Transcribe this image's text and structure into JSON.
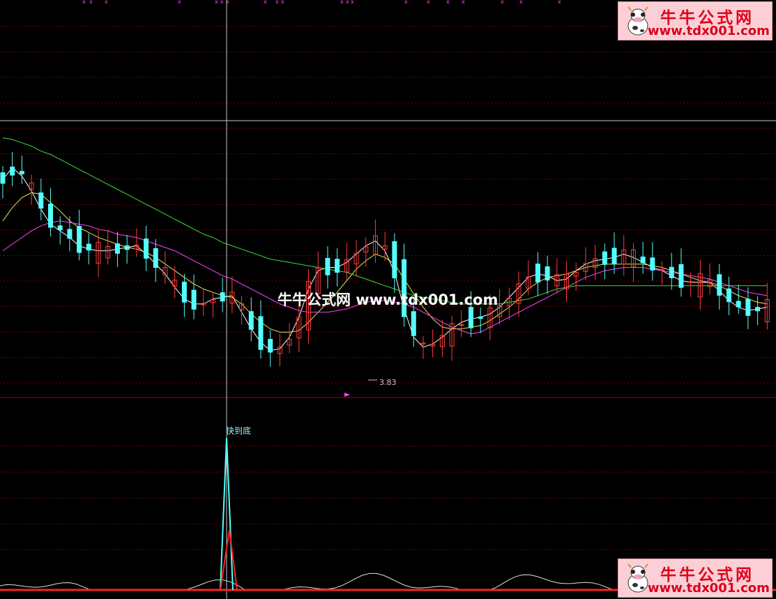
{
  "watermark_text": "牛牛公式网 www.tdx001.com",
  "badge": {
    "name": "牛牛公式网",
    "url": "www.tdx001.com",
    "icon": "cow-mascot-icon"
  },
  "colors": {
    "up": "#ff3c3c",
    "down": "#54ffff",
    "ma5": "#ffffff",
    "ma10": "#e6e64e",
    "ma20": "#ff44ff",
    "ma60": "#3edc3e",
    "grid": "#7a0000",
    "crosshair": "#c8c8c8",
    "signal": "#54ffff",
    "signal_red": "#ff2020"
  },
  "chart_data": [
    {
      "type": "candlestick",
      "title": "",
      "annotations": {
        "low_marker": "3.83",
        "top_marks": "x"
      },
      "ylim": [
        3.7,
        5.4
      ],
      "ohlc": [],
      "ma_series": [
        {
          "key": "ma5",
          "values": [
            4.95,
            5.02,
            4.97,
            4.88,
            4.77,
            4.68,
            4.64,
            4.6,
            4.55,
            4.53,
            4.52,
            4.52,
            4.53,
            4.54,
            4.55,
            4.5,
            4.44,
            4.38,
            4.3,
            4.23,
            4.2,
            4.2,
            4.23,
            4.24,
            4.25,
            4.15,
            4.05,
            3.97,
            3.92,
            3.93,
            4.0,
            4.12,
            4.29,
            4.4,
            4.42,
            4.42,
            4.45,
            4.5,
            4.55,
            4.58,
            4.52,
            4.39,
            4.17,
            4.0,
            3.94,
            3.96,
            4.0,
            4.05,
            4.09,
            4.11,
            4.12,
            4.14,
            4.18,
            4.24,
            4.3,
            4.36,
            4.38,
            4.37,
            4.34,
            4.35,
            4.4,
            4.44,
            4.46,
            4.47,
            4.48,
            4.5,
            4.48,
            4.45,
            4.42,
            4.4,
            4.37,
            4.34,
            4.33,
            4.33,
            4.33,
            4.28,
            4.22,
            4.18,
            4.16,
            4.17,
            4.18
          ]
        },
        {
          "key": "ma10",
          "values": [
            4.7,
            4.78,
            4.84,
            4.87,
            4.86,
            4.81,
            4.76,
            4.7,
            4.66,
            4.63,
            4.6,
            4.58,
            4.56,
            4.54,
            4.53,
            4.51,
            4.48,
            4.44,
            4.4,
            4.36,
            4.32,
            4.29,
            4.27,
            4.25,
            4.24,
            4.2,
            4.14,
            4.09,
            4.05,
            4.03,
            4.03,
            4.04,
            4.09,
            4.15,
            4.21,
            4.27,
            4.34,
            4.41,
            4.46,
            4.5,
            4.48,
            4.44,
            4.35,
            4.26,
            4.18,
            4.11,
            4.06,
            4.05,
            4.05,
            4.06,
            4.07,
            4.1,
            4.14,
            4.18,
            4.23,
            4.29,
            4.33,
            4.36,
            4.37,
            4.38,
            4.4,
            4.42,
            4.43,
            4.44,
            4.44,
            4.44,
            4.44,
            4.44,
            4.43,
            4.42,
            4.4,
            4.38,
            4.36,
            4.34,
            4.33,
            4.31,
            4.28,
            4.25,
            4.23,
            4.21,
            4.2
          ]
        },
        {
          "key": "ma20",
          "values": [
            4.52,
            4.56,
            4.6,
            4.64,
            4.67,
            4.69,
            4.7,
            4.69,
            4.68,
            4.67,
            4.65,
            4.64,
            4.62,
            4.61,
            4.6,
            4.58,
            4.56,
            4.54,
            4.52,
            4.49,
            4.46,
            4.43,
            4.4,
            4.37,
            4.35,
            4.32,
            4.29,
            4.26,
            4.23,
            4.2,
            4.18,
            4.16,
            4.15,
            4.15,
            4.15,
            4.16,
            4.17,
            4.19,
            4.21,
            4.22,
            4.22,
            4.21,
            4.2,
            4.18,
            4.15,
            4.12,
            4.09,
            4.06,
            4.04,
            4.02,
            4.03,
            4.06,
            4.09,
            4.12,
            4.15,
            4.18,
            4.21,
            4.24,
            4.27,
            4.3,
            4.33,
            4.36,
            4.38,
            4.4,
            4.41,
            4.42,
            4.42,
            4.42,
            4.41,
            4.4,
            4.39,
            4.38,
            4.37,
            4.36,
            4.35,
            4.33,
            4.31,
            4.29,
            4.27,
            4.26,
            4.25
          ]
        },
        {
          "key": "ma60",
          "values": [
            5.2,
            5.19,
            5.17,
            5.15,
            5.12,
            5.1,
            5.07,
            5.04,
            5.01,
            4.98,
            4.95,
            4.92,
            4.89,
            4.86,
            4.83,
            4.8,
            4.77,
            4.74,
            4.71,
            4.68,
            4.65,
            4.62,
            4.6,
            4.57,
            4.55,
            4.53,
            4.51,
            4.49,
            4.47,
            4.46,
            4.45,
            4.44,
            4.43,
            4.42,
            4.41,
            4.4,
            4.39,
            4.37,
            4.35,
            4.33,
            4.31,
            4.29,
            4.27,
            4.25,
            4.24,
            4.23,
            4.22,
            4.21,
            4.2,
            4.2,
            4.2,
            4.2,
            4.2,
            4.21,
            4.22,
            4.23,
            4.25,
            4.27,
            4.29,
            4.3,
            4.31,
            4.31,
            4.31,
            4.31,
            4.31,
            4.31,
            4.31,
            4.31,
            4.31,
            4.31,
            4.31,
            4.31,
            4.31,
            4.31,
            4.31,
            4.31,
            4.31,
            4.31,
            4.31,
            4.31,
            4.31
          ]
        }
      ]
    },
    {
      "type": "line",
      "title": "",
      "annotation": "快到底",
      "series": [
        {
          "key": "signal",
          "values": []
        },
        {
          "key": "aux",
          "values": []
        }
      ]
    }
  ]
}
